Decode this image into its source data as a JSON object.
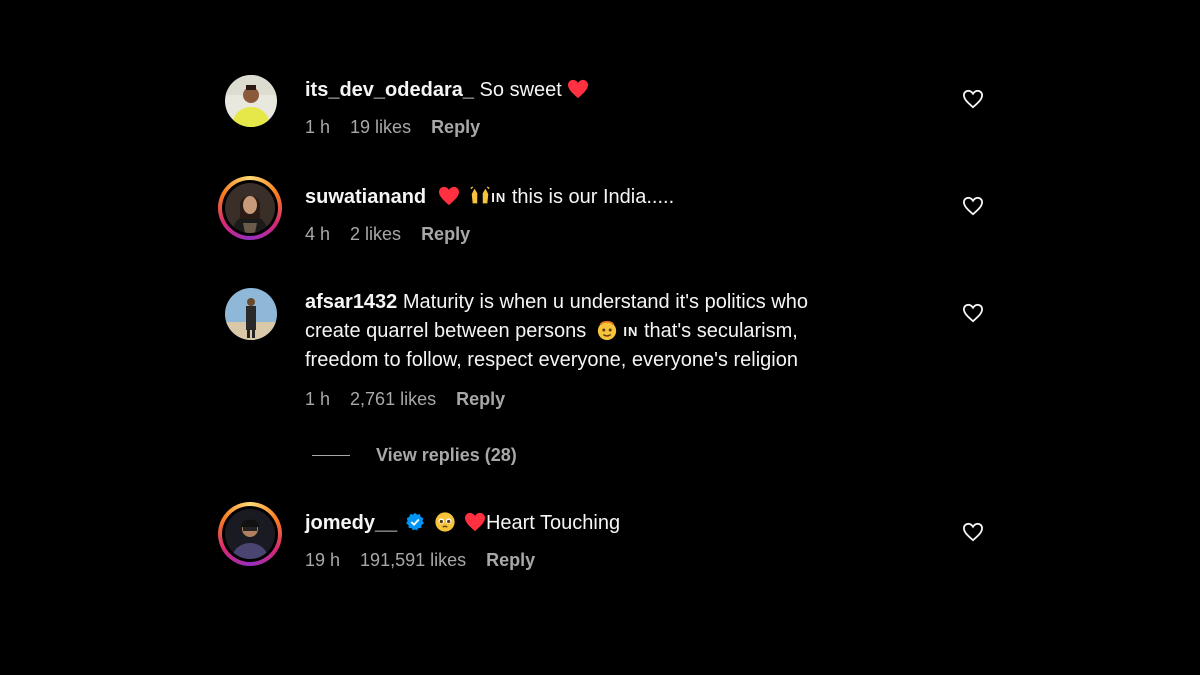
{
  "comments": [
    {
      "username": "its_dev_odedara_",
      "text": "So sweet",
      "time": "1 h",
      "likes": "19 likes",
      "reply": "Reply",
      "avatar_story_ring": false
    },
    {
      "username": "suwatianand",
      "text_flag": "IN",
      "text": "this is our India.....",
      "time": "4 h",
      "likes": "2 likes",
      "reply": "Reply",
      "avatar_story_ring": true
    },
    {
      "username": "afsar1432",
      "text_line1": "Maturity is when u understand it's politics who",
      "text_line2a": "create quarrel between persons",
      "text_flag": "IN",
      "text_line2b": "that's secularism,",
      "text_line3": "freedom to follow, respect everyone, everyone's religion",
      "time": "1 h",
      "likes": "2,761 likes",
      "reply": "Reply",
      "avatar_story_ring": false,
      "view_replies": "View replies (28)"
    },
    {
      "username": "jomedy__",
      "verified": true,
      "text": "Heart Touching",
      "time": "19 h",
      "likes": "191,591 likes",
      "reply": "Reply",
      "avatar_story_ring": true
    }
  ],
  "icons": {
    "like": "heart-outline-icon",
    "emoji_heart": "red-heart-emoji",
    "emoji_hands": "raising-hands-emoji",
    "emoji_face": "face-emoji",
    "verified": "verified-badge-icon"
  },
  "colors": {
    "background": "#000000",
    "text": "#f5f5f5",
    "secondary": "#a8a8a8",
    "heart": "#ff3040",
    "verified": "#0095f6"
  }
}
